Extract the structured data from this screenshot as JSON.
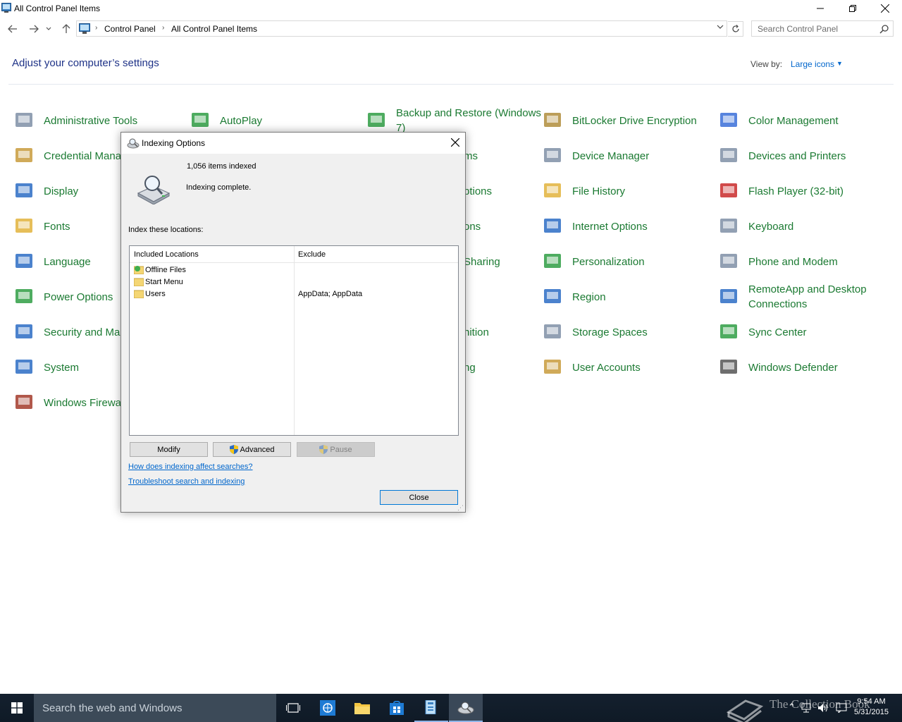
{
  "window": {
    "title": "All Control Panel Items",
    "min_icon": "minimize-icon",
    "max_icon": "restore-icon",
    "close_icon": "close-icon"
  },
  "address_bar": {
    "crumbs": [
      "Control Panel",
      "All Control Panel Items"
    ],
    "search_placeholder": "Search Control Panel"
  },
  "header": {
    "title": "Adjust your computer’s settings",
    "view_by_label": "View by:",
    "view_by_value": "Large icons"
  },
  "items": [
    {
      "label": "Administrative Tools",
      "icon": "admin-tools-icon",
      "color": "#7f8fa6"
    },
    {
      "label": "AutoPlay",
      "icon": "autoplay-icon",
      "color": "#2f9e44"
    },
    {
      "label": "Backup and Restore (Windows 7)",
      "icon": "backup-icon",
      "color": "#2f9e44"
    },
    {
      "label": "BitLocker Drive Encryption",
      "icon": "bitlocker-icon",
      "color": "#b08d3c"
    },
    {
      "label": "Color Management",
      "icon": "color-management-icon",
      "color": "#3a6fd8"
    },
    {
      "label": "Credential Mana",
      "icon": "credential-icon",
      "color": "#c89b3c"
    },
    {
      "label": "ms",
      "icon": "hidden-icon",
      "color": "#ffffff"
    },
    {
      "label": "Device Manager",
      "icon": "device-manager-icon",
      "color": "#7f8fa6"
    },
    {
      "label": "Devices and Printers",
      "icon": "printer-icon",
      "color": "#7f8fa6"
    },
    {
      "label": "Display",
      "icon": "display-icon",
      "color": "#2b6cc4"
    },
    {
      "label": "ptions",
      "icon": "hidden-icon",
      "color": "#ffffff"
    },
    {
      "label": "File History",
      "icon": "file-history-icon",
      "color": "#e2b33c"
    },
    {
      "label": "Flash Player (32-bit)",
      "icon": "flash-icon",
      "color": "#c92a2a"
    },
    {
      "label": "Fonts",
      "icon": "fonts-icon",
      "color": "#e2b33c"
    },
    {
      "label": "ons",
      "icon": "hidden-icon",
      "color": "#ffffff"
    },
    {
      "label": "Internet Options",
      "icon": "internet-options-icon",
      "color": "#2b6cc4"
    },
    {
      "label": "Keyboard",
      "icon": "keyboard-icon",
      "color": "#7f8fa6"
    },
    {
      "label": "Language",
      "icon": "language-icon",
      "color": "#2b6cc4"
    },
    {
      "label": "Sharing",
      "icon": "hidden-icon",
      "color": "#ffffff"
    },
    {
      "label": "Personalization",
      "icon": "personalization-icon",
      "color": "#2f9e44"
    },
    {
      "label": "Phone and Modem",
      "icon": "phone-icon",
      "color": "#7f8fa6"
    },
    {
      "label": "Power Options",
      "icon": "power-icon",
      "color": "#2f9e44"
    },
    {
      "label": "Region",
      "icon": "region-icon",
      "color": "#2b6cc4"
    },
    {
      "label": "RemoteApp and Desktop Connections",
      "icon": "remoteapp-icon",
      "color": "#2b6cc4"
    },
    {
      "label": "Security and Ma",
      "icon": "security-flag-icon",
      "color": "#2b6cc4"
    },
    {
      "label": "nition",
      "icon": "hidden-icon",
      "color": "#ffffff"
    },
    {
      "label": "Storage Spaces",
      "icon": "storage-spaces-icon",
      "color": "#7f8fa6"
    },
    {
      "label": "Sync Center",
      "icon": "sync-icon",
      "color": "#2f9e44"
    },
    {
      "label": "System",
      "icon": "system-icon",
      "color": "#2b6cc4"
    },
    {
      "label": "ng",
      "icon": "hidden-icon",
      "color": "#ffffff"
    },
    {
      "label": "User Accounts",
      "icon": "user-accounts-icon",
      "color": "#c89b3c"
    },
    {
      "label": "Windows Defender",
      "icon": "defender-icon",
      "color": "#555555"
    },
    {
      "label": "Windows Firewa",
      "icon": "firewall-icon",
      "color": "#a33b2b"
    }
  ],
  "dialog": {
    "title": "Indexing Options",
    "items_indexed": "1,056 items indexed",
    "status": "Indexing complete.",
    "index_label": "Index these locations:",
    "col_included": "Included Locations",
    "col_exclude": "Exclude",
    "rows": [
      {
        "name": "Offline Files",
        "exclude": ""
      },
      {
        "name": "Start Menu",
        "exclude": ""
      },
      {
        "name": "Users",
        "exclude": "AppData; AppData"
      }
    ],
    "modify": "Modify",
    "advanced": "Advanced",
    "pause": "Pause",
    "link1": "How does indexing affect searches?",
    "link2": "Troubleshoot search and indexing",
    "close": "Close"
  },
  "taskbar": {
    "search_placeholder": "Search the web and Windows",
    "watermark": "The Collection Book",
    "time": "9:54 AM",
    "date": "5/31/2015"
  }
}
